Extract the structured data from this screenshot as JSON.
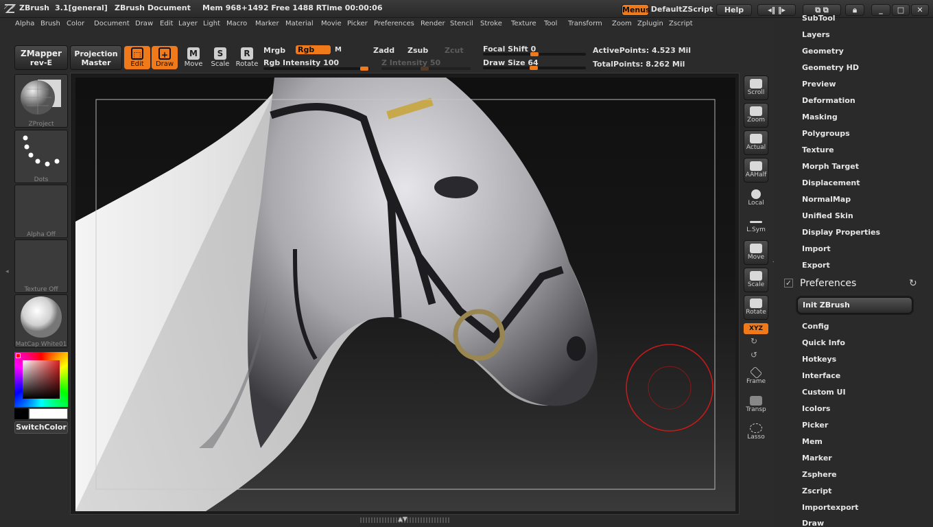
{
  "titlebar": {
    "app": "ZBrush",
    "version": "3.1[general]",
    "document": "ZBrush Document",
    "mem": "Mem 968+1492 Free 1488 RTime 00:00:06",
    "menus_btn": "Menus",
    "script_btn": "DefaultZScript",
    "help_btn": "Help"
  },
  "menubar": [
    "Alpha",
    "Brush",
    "Color",
    "Document",
    "Draw",
    "Edit",
    "Layer",
    "Light",
    "Macro",
    "Marker",
    "Material",
    "Movie",
    "Picker",
    "Preferences",
    "Render",
    "Stencil",
    "Stroke",
    "Texture",
    "Tool",
    "Transform",
    "Zoom",
    "Zplugin",
    "Zscript"
  ],
  "toolbar": {
    "zmapper": "ZMapper",
    "zmapper_sub": "rev-E",
    "projection": "Projection",
    "projection_sub": "Master",
    "edit": "Edit",
    "draw": "Draw",
    "move": "Move",
    "scale": "Scale",
    "rotate": "Rotate",
    "mrgb": "Mrgb",
    "rgb": "Rgb",
    "m": "M",
    "rgb_intensity": "Rgb Intensity 100",
    "zadd": "Zadd",
    "zsub": "Zsub",
    "zcut": "Zcut",
    "z_intensity": "Z Intensity 50",
    "focal_shift": "Focal Shift 0",
    "draw_size": "Draw Size 64",
    "active_points": "ActivePoints: 4.523 Mil",
    "total_points": "TotalPoints: 8.262 Mil"
  },
  "left_shelf": {
    "brush": "ZProject",
    "stroke": "Dots",
    "alpha": "Alpha Off",
    "texture": "Texture Off",
    "material": "MatCap White01",
    "switch_color": "SwitchColor"
  },
  "right_tools": [
    "Scroll",
    "Zoom",
    "Actual",
    "AAHalf",
    "Local",
    "L.Sym",
    "Move",
    "Scale",
    "Rotate",
    "XYZ",
    "Frame",
    "Transp",
    "Lasso"
  ],
  "palette": {
    "top_items": [
      "SubTool",
      "Layers",
      "Geometry",
      "Geometry HD",
      "Preview",
      "Deformation",
      "Masking",
      "Polygroups",
      "Texture",
      "Morph Target",
      "Displacement",
      "NormalMap",
      "Unified Skin",
      "Display Properties",
      "Import",
      "Export"
    ],
    "section_title": "Preferences",
    "init_button": "Init ZBrush",
    "pref_items": [
      "Config",
      "Quick Info",
      "Hotkeys",
      "Interface",
      "Custom UI",
      "Icolors",
      "Picker",
      "Mem",
      "Marker",
      "Zsphere",
      "Zscript",
      "Importexport",
      "Draw"
    ]
  },
  "colors": {
    "accent": "#f07a1a",
    "brush_cursor": "#c41a1a"
  }
}
